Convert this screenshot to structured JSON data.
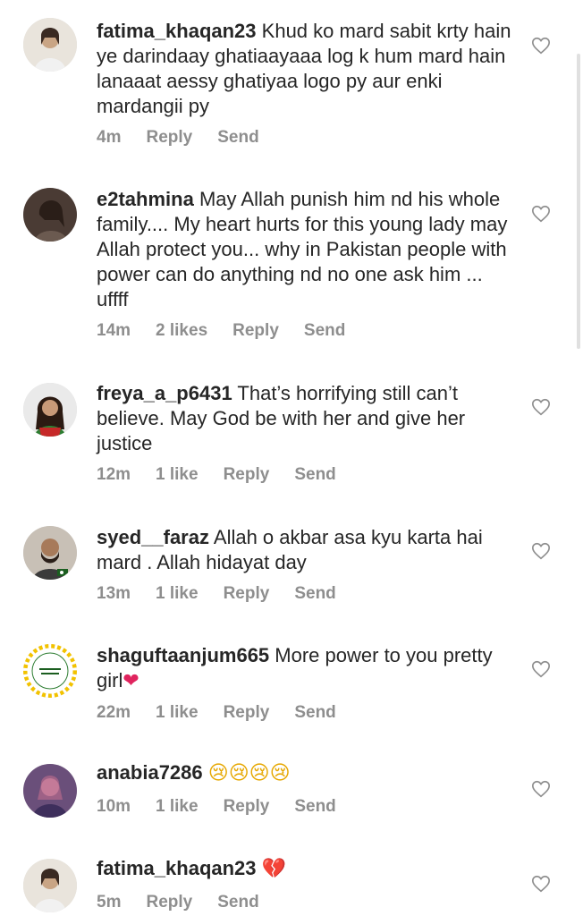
{
  "comments": [
    {
      "username": "fatima_khaqan23",
      "text": "Khud ko mard sabit krty hain ye darindaay ghatiaayaaa log k hum mard hain lanaaat aessy ghatiyaa logo py aur enki mardangii py",
      "time": "4m",
      "likes": "",
      "reply": "Reply",
      "send": "Send"
    },
    {
      "username": "e2tahmina",
      "text": "May Allah punish him nd his whole family.... My heart hurts for this young lady may Allah protect you... why in Pakistan people with power can do anything nd no one ask him ... uffff",
      "time": "14m",
      "likes": "2 likes",
      "reply": "Reply",
      "send": "Send"
    },
    {
      "username": "freya_a_p6431",
      "text": "That’s horrifying still can’t believe. May God be with her and give her justice",
      "time": "12m",
      "likes": "1 like",
      "reply": "Reply",
      "send": "Send"
    },
    {
      "username": "syed__faraz",
      "text": "Allah o akbar asa kyu karta hai mard . Allah hidayat day",
      "time": "13m",
      "likes": "1 like",
      "reply": "Reply",
      "send": "Send"
    },
    {
      "username": "shaguftaanjum665",
      "text": "More power to you pretty girl",
      "emoji": "❤",
      "time": "22m",
      "likes": "1 like",
      "reply": "Reply",
      "send": "Send"
    },
    {
      "username": "anabia7286",
      "text": "",
      "emoji": "😢😢😢😢",
      "time": "10m",
      "likes": "1 like",
      "reply": "Reply",
      "send": "Send"
    },
    {
      "username": "fatima_khaqan23",
      "text": "",
      "emoji": "💔",
      "time": "5m",
      "likes": "",
      "reply": "Reply",
      "send": "Send"
    }
  ],
  "icons": {
    "like": "heart-outline-icon"
  },
  "colors": {
    "text": "#262626",
    "meta": "#8e8e8e",
    "heart_emoji": "#e0245e"
  }
}
